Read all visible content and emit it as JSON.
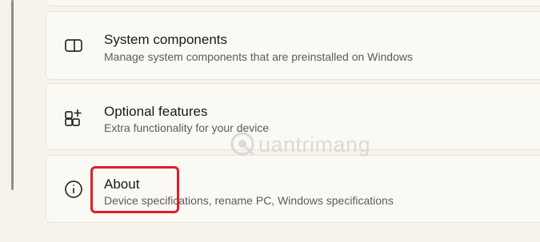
{
  "settings_list": {
    "items": [
      {
        "icon": "system-components-icon",
        "title": "System components",
        "subtitle": "Manage system components that are preinstalled on Windows"
      },
      {
        "icon": "optional-features-icon",
        "title": "Optional features",
        "subtitle": "Extra functionality for your device"
      },
      {
        "icon": "info-icon",
        "title": "About",
        "subtitle": "Device specifications, rename PC, Windows specifications"
      }
    ]
  },
  "highlight": {
    "target": "About",
    "color": "#dd1f2b"
  },
  "watermark": {
    "text": "uantrimang"
  }
}
